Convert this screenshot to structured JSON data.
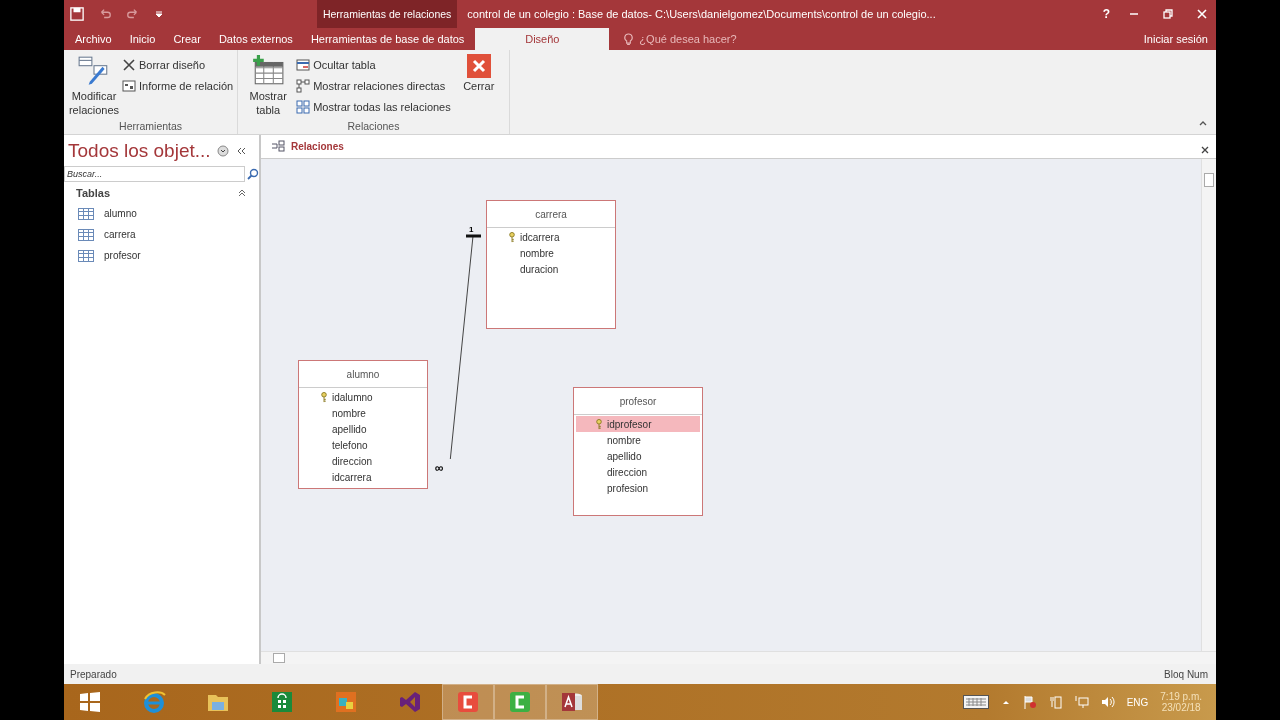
{
  "window": {
    "title": "control de un colegio : Base de datos- C:\\Users\\danielgomez\\Documents\\control de un colegio...",
    "context_group": "Herramientas de relaciones",
    "help": "?"
  },
  "ribbon_tabs": [
    {
      "label": "Archivo",
      "selected": false
    },
    {
      "label": "Inicio",
      "selected": false
    },
    {
      "label": "Crear",
      "selected": false
    },
    {
      "label": "Datos externos",
      "selected": false
    },
    {
      "label": "Herramientas de base de datos",
      "selected": false
    },
    {
      "label": "Diseño",
      "selected": true
    }
  ],
  "tell_me": {
    "placeholder": "¿Qué desea hacer?"
  },
  "sign_in": "Iniciar sesión",
  "ribbon_groups": [
    {
      "label": "Herramientas",
      "large": [
        {
          "kind": "edit",
          "label": "Modificar relaciones"
        }
      ],
      "small": [
        {
          "kind": "clear",
          "label": "Borrar diseño"
        },
        {
          "kind": "report",
          "label": "Informe de relación"
        }
      ]
    },
    {
      "label": "Relaciones",
      "large": [
        {
          "kind": "table",
          "label": "Mostrar tabla"
        }
      ],
      "small": [
        {
          "kind": "hide",
          "label": "Ocultar tabla"
        },
        {
          "kind": "direct",
          "label": "Mostrar relaciones directas"
        },
        {
          "kind": "all",
          "label": "Mostrar todas las relaciones"
        }
      ],
      "trailing": [
        {
          "kind": "close",
          "label": "Cerrar"
        }
      ]
    }
  ],
  "nav_pane": {
    "title": "Todos los objet...",
    "search": {
      "placeholder": "Buscar..."
    },
    "group": "Tablas",
    "items": [
      "alumno",
      "carrera",
      "profesor"
    ]
  },
  "doc_tabs": [
    {
      "label": "Relaciones",
      "selected": true
    }
  ],
  "tables": [
    {
      "name": "carrera",
      "fields": [
        {
          "name": "idcarrera",
          "key": true,
          "selected": false
        },
        {
          "name": "nombre",
          "key": false,
          "selected": false
        },
        {
          "name": "duracion",
          "key": false,
          "selected": false
        }
      ]
    },
    {
      "name": "alumno",
      "fields": [
        {
          "name": "idalumno",
          "key": true,
          "selected": false
        },
        {
          "name": "nombre",
          "key": false,
          "selected": false
        },
        {
          "name": "apellido",
          "key": false,
          "selected": false
        },
        {
          "name": "telefono",
          "key": false,
          "selected": false
        },
        {
          "name": "direccion",
          "key": false,
          "selected": false
        },
        {
          "name": "idcarrera",
          "key": false,
          "selected": false
        }
      ]
    },
    {
      "name": "profesor",
      "fields": [
        {
          "name": "idprofesor",
          "key": true,
          "selected": true
        },
        {
          "name": "nombre",
          "key": false,
          "selected": false
        },
        {
          "name": "apellido",
          "key": false,
          "selected": false
        },
        {
          "name": "direccion",
          "key": false,
          "selected": false
        },
        {
          "name": "profesion",
          "key": false,
          "selected": false
        }
      ]
    }
  ],
  "relationship": {
    "one_label": "1",
    "many_label": "∞"
  },
  "status_bar": {
    "left": "Preparado",
    "right": "Bloq Num"
  },
  "taskbar": {
    "apps": [
      {
        "kind": "start",
        "active": false
      },
      {
        "kind": "browser",
        "active": false
      },
      {
        "kind": "folder",
        "active": false
      },
      {
        "kind": "store",
        "active": false
      },
      {
        "kind": "game",
        "active": false
      },
      {
        "kind": "studio",
        "active": false
      },
      {
        "kind": "recorder",
        "active": true
      },
      {
        "kind": "editor",
        "active": true
      },
      {
        "kind": "database",
        "active": true
      }
    ],
    "language": "ENG",
    "time": "7:19 p.m.",
    "date": "23/02/18"
  }
}
